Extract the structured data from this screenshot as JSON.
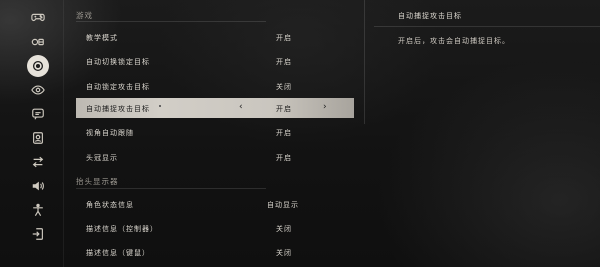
{
  "sidebar": {
    "items": [
      {
        "icon": "gamepad-icon"
      },
      {
        "icon": "controller-buttons-icon"
      },
      {
        "icon": "target-icon",
        "active": true
      },
      {
        "icon": "eye-icon"
      },
      {
        "icon": "chat-icon"
      },
      {
        "icon": "portrait-icon"
      },
      {
        "icon": "swap-arrows-icon"
      },
      {
        "icon": "speaker-icon"
      },
      {
        "icon": "accessibility-icon"
      },
      {
        "icon": "exit-icon"
      }
    ]
  },
  "sections": [
    {
      "title": "游戏"
    },
    {
      "title": "抬头显示器"
    }
  ],
  "rows": [
    {
      "label": "教学模式",
      "value": "开启"
    },
    {
      "label": "自动切换锁定目标",
      "value": "开启"
    },
    {
      "label": "自动锁定攻击目标",
      "value": "关闭"
    },
    {
      "label": "自动捕捉攻击目标",
      "value": "开启"
    },
    {
      "label": "视角自动跟随",
      "value": "开启"
    },
    {
      "label": "头冠显示",
      "value": "开启"
    },
    {
      "label": "角色状态信息",
      "value": "自动显示"
    },
    {
      "label": "描述信息（控制器）",
      "value": "关闭"
    },
    {
      "label": "描述信息（键鼠）",
      "value": "关闭"
    }
  ],
  "selector": {
    "prev": "‹",
    "next": "›"
  },
  "detail": {
    "title": "自动捕捉攻击目标",
    "text": "开启后，攻击会自动捕捉目标。"
  }
}
